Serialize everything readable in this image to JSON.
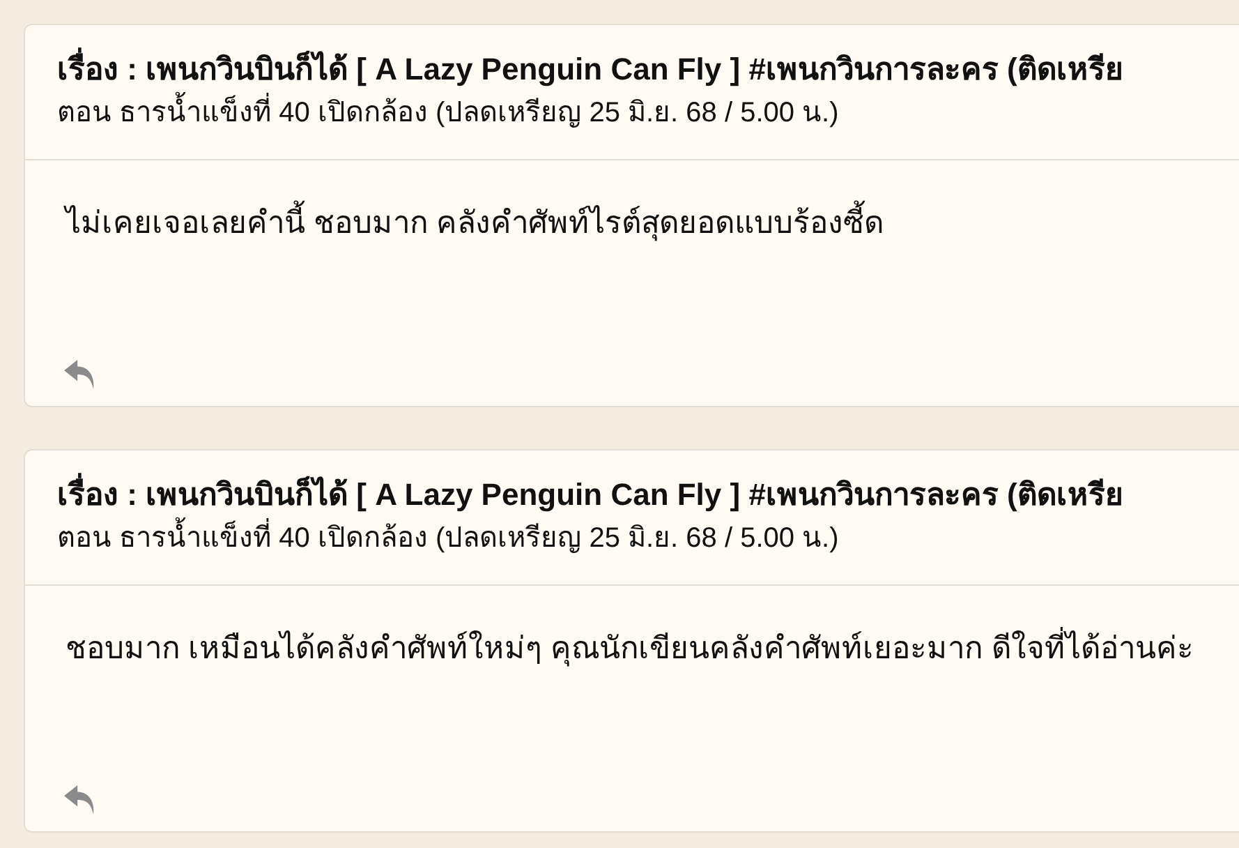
{
  "comments": [
    {
      "title": "เรื่อง : เพนกวินบินก็ได้ [ A Lazy Penguin Can Fly ] #เพนกวินการละคร (ติดเหรีย",
      "episode": "ตอน ธารน้ำแข็งที่ 40 เปิดกล้อง (ปลดเหรียญ 25 มิ.ย. 68 / 5.00 น.)",
      "body": "ไม่เคยเจอเลยคำนี้ ชอบมาก คลังคำศัพท์ไรต์สุดยอดแบบร้องซี้ด"
    },
    {
      "title": "เรื่อง : เพนกวินบินก็ได้ [ A Lazy Penguin Can Fly ] #เพนกวินการละคร (ติดเหรีย",
      "episode": "ตอน ธารน้ำแข็งที่ 40 เปิดกล้อง (ปลดเหรียญ 25 มิ.ย. 68 / 5.00 น.)",
      "body": "ชอบมาก เหมือนได้คลังคำศัพท์ใหม่ๆ คุณนักเขียนคลังคำศัพท์เยอะมาก ดีใจที่ได้อ่านค่ะ"
    }
  ]
}
